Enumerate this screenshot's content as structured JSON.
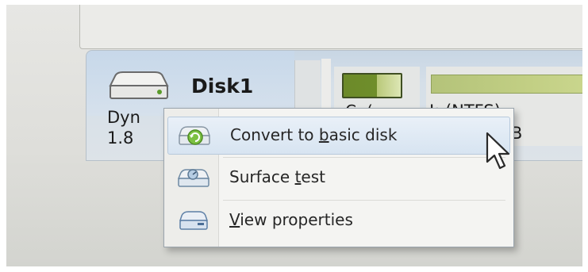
{
  "disk": {
    "name": "Disk1",
    "type_text": "Dyn",
    "size_text": "1.8",
    "icon": "hard-disk-icon"
  },
  "partitions": [
    {
      "label_text": "C: (",
      "bar_fill_fraction": 0.6,
      "bar_color": "#6f8e2b"
    },
    {
      "label_text": "I: (NTFS)",
      "size_text": "TB",
      "bar_color": "#c2cf84"
    }
  ],
  "context_menu": {
    "items": [
      {
        "label": "Convert to basic disk",
        "underline_char": "b",
        "icon": "convert-disk-icon",
        "highlighted": true
      },
      {
        "label": "Surface test",
        "underline_char": "t",
        "icon": "surface-test-icon",
        "highlighted": false
      },
      {
        "label": "View properties",
        "underline_char": "V",
        "icon": "properties-icon",
        "highlighted": false
      }
    ]
  },
  "colors": {
    "highlight": "#d7e4f1",
    "panel": "#c8d6e4",
    "partition_used": "#6f8e2b",
    "partition_free": "#c2cf84"
  }
}
